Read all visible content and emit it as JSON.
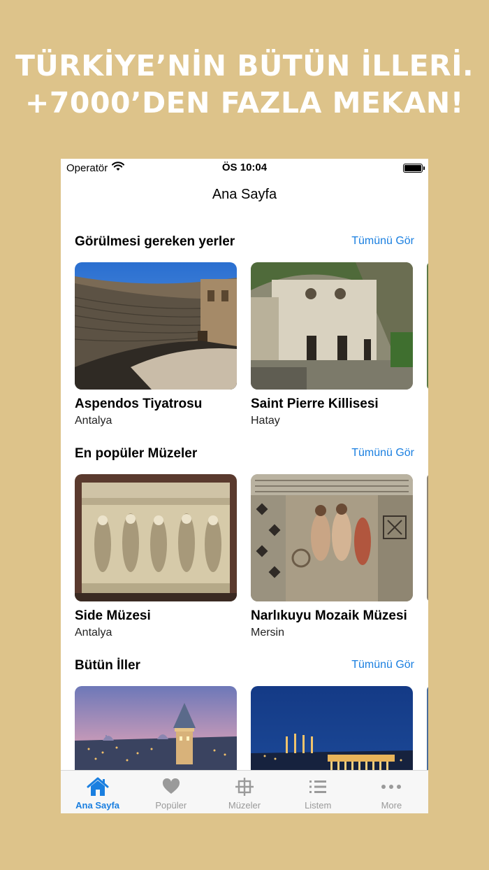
{
  "promo": {
    "line1": "TÜRKİYE’NİN BÜTÜN İLLERİ.",
    "line2": "+7000’DEN FAZLA MEKAN!"
  },
  "statusbar": {
    "carrier": "Operatör",
    "time": "ÖS 10:04"
  },
  "nav": {
    "title": "Ana Sayfa"
  },
  "sections": [
    {
      "title": "Görülmesi gereken yerler",
      "see_all": "Tümünü Gör",
      "cards": [
        {
          "title": "Aspendos Tiyatrosu",
          "subtitle": "Antalya"
        },
        {
          "title": "Saint Pierre Killisesi",
          "subtitle": "Hatay"
        }
      ]
    },
    {
      "title": "En popüler Müzeler",
      "see_all": "Tümünü Gör",
      "cards": [
        {
          "title": "Side Müzesi",
          "subtitle": "Antalya"
        },
        {
          "title": "Narlıkuyu Mozaik Müzesi",
          "subtitle": "Mersin"
        }
      ]
    },
    {
      "title": "Bütün İller",
      "see_all": "Tümünü Gör",
      "cards": []
    }
  ],
  "tabs": [
    {
      "label": "Ana Sayfa",
      "icon": "house-icon",
      "active": true
    },
    {
      "label": "Popüler",
      "icon": "heart-icon",
      "active": false
    },
    {
      "label": "Müzeler",
      "icon": "museum-icon",
      "active": false
    },
    {
      "label": "Listem",
      "icon": "list-icon",
      "active": false
    },
    {
      "label": "More",
      "icon": "more-icon",
      "active": false
    }
  ],
  "colors": {
    "background": "#ddc38a",
    "accent": "#1a7fe0",
    "tab_inactive": "#999999"
  }
}
